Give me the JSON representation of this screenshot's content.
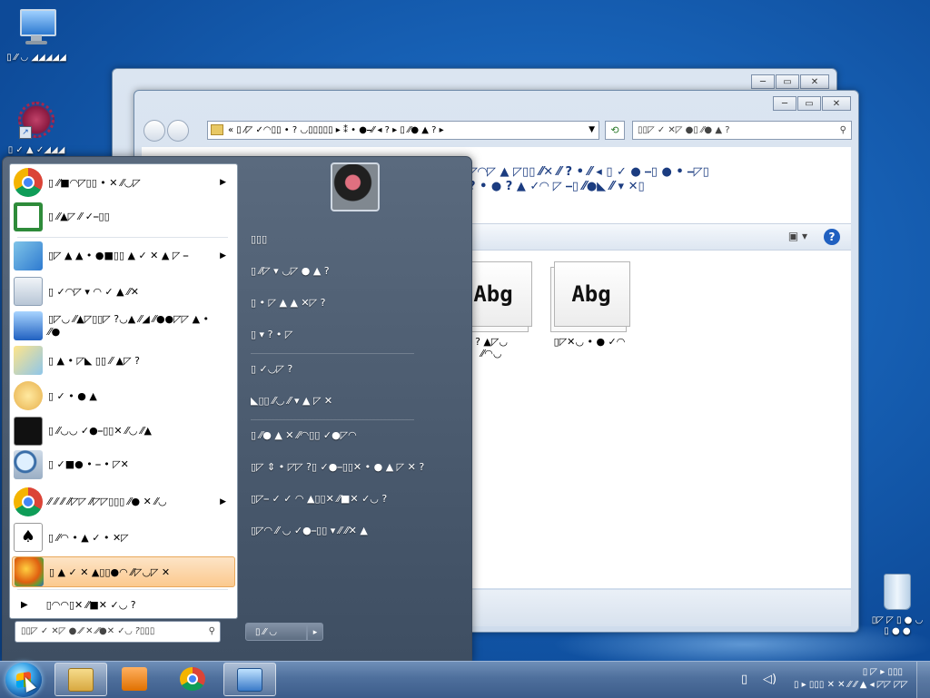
{
  "desktop": {
    "icons": [
      {
        "label": "▯ ⁄⁄ ◡ ◢◢◢◢◢",
        "glyph": "computer-icon"
      },
      {
        "label": "▯ ✓ ▲ ✓◢◢◢",
        "glyph": "web-archive-icon"
      }
    ],
    "recycle_bin_label_line1": "▯◸ ◸ ▯ ● ◡",
    "recycle_bin_label_line2": "▯ ● ●"
  },
  "explorer_back": {
    "min_label": "─",
    "max_label": "▭",
    "close_label": "✕"
  },
  "explorer_front": {
    "min_label": "─",
    "max_label": "▭",
    "close_label": "✕",
    "address_path": "« ▯ ⁄◸ ✓◠▯▯ • ? ◡▯▯▯▯▯  ▸  ⁑ • ●⎯⁄⁄ ◂ ?  ▸ ▯ ⁄⁄● ▲ ?  ▸",
    "search_placeholder": "▯▯◸ ✓ ✕◸ ●▯ ⁄⁄● ▲ ?",
    "info_line1": "◸◠◸ ▲ ◸▯▯ ⁄⁄✕ ⁄⁄ ? • ⁄⁄ ◂ ▯ ✓ ● ⎯▯ ● • ⎯◸▯",
    "info_line2": "? • ● ? ▲ ✓◠ ◸ ⎯▯ ⁄⁄●◣ ⁄⁄ ▾ ✕▯",
    "font_files": [
      {
        "preview": "Abg",
        "name_line1": "? ▲◸◡",
        "name_line2": "⁄⁄◠◡"
      },
      {
        "preview": "Abg",
        "name_line1": "▯◸✕◡ • ● ✓◠",
        "name_line2": ""
      }
    ]
  },
  "start_menu": {
    "left_items": [
      {
        "label": "▯ ⁄⁄■◠◸▯▯ • ✕ ⁄⁄◡◸",
        "icon": "chrome-icon",
        "has_arrow": true
      },
      {
        "label": "▯ ⁄⁄▲◸ ⁄⁄ ✓⎯▯▯",
        "icon": "task-manager-icon",
        "has_arrow": false
      },
      {
        "label": "▯◸ ▲ ▲ • ●■▯▯ ▲ ✓ ✕ ▲ ◸ ⎯",
        "icon": "control-panel-icon",
        "has_arrow": true
      },
      {
        "label": "▯ ✓◠◸ ▾ ◠ ✓ ▲ ⁄⁄✕",
        "icon": "calculator-icon",
        "has_arrow": false
      },
      {
        "label": "▯◸◡ ⁄⁄▲◸▯▯◸ ?◡▲ ⁄⁄◢ ⁄⁄●●◸◸ ▲ • ⁄⁄●",
        "icon": "remote-desktop-icon",
        "has_arrow": false
      },
      {
        "label": "▯ ▲ • ◸◣ ▯▯ ⁄⁄ ▲◸ ?",
        "icon": "snipping-tool-icon",
        "has_arrow": false
      },
      {
        "label": "▯ ✓ • ● ▲",
        "icon": "paint-icon",
        "has_arrow": false
      },
      {
        "label": "▯ ⁄⁄◡◡ ✓●⎯▯▯✕ ⁄⁄◡ ⁄⁄▲",
        "icon": "command-prompt-icon",
        "has_arrow": false
      },
      {
        "label": "▯ ✓■● • ⎯ • ◸✕",
        "icon": "magnifier-icon",
        "has_arrow": false
      },
      {
        "label": "⁄⁄ ⁄⁄ ⁄⁄ ⁄⁄◸◸ ⁄⁄◸◸▯▯▯ ⁄⁄● ✕ ⁄⁄◡",
        "icon": "chrome-user-icon",
        "has_arrow": true
      },
      {
        "label": "▯ ⁄⁄◠ • ▲ ✓ • ✕◸",
        "icon": "solitaire-icon",
        "has_arrow": false
      },
      {
        "label": "▯ ▲ ✓ ✕ ▲▯▯●◠ ⁄⁄◸◡◸ ✕",
        "icon": "getting-started-icon",
        "has_arrow": false,
        "highlighted": true
      }
    ],
    "all_programs_label": "▯◠◠▯✕ ⁄⁄■✕ ✓◡ ?",
    "search_placeholder": "▯▯◸ ✓ ✕◸ ● ⁄⁄ ✕ ⁄⁄●✕ ✓◡ ?▯▯▯",
    "right_items": [
      "▯▯▯",
      "▯ ⁄⁄◸ ▾ ◡◸ ● ▲ ?",
      "▯ • ◸ ▲ ▲ ✕◸ ?",
      "▯ ▾ ? • ◸",
      "▯ ✓◡◸ ?",
      "◣▯▯ ⁄⁄◡ ⁄⁄ ▾ ▲ ◸ ✕",
      "▯ ⁄⁄● ▲ ✕ ⁄⁄◠▯▯ ✓●◸◠",
      "▯◸ ⇕ • ◸◸ ?▯ ✓●⎯▯▯✕ • ● ▲ ◸ ✕ ?",
      "▯◸⎯ ✓ ✓ ◠ ▲▯▯✕ ⁄⁄■✕ ✓◡ ?",
      "▯◸◠ ⁄⁄ ◡ ✓●⎯▯▯ ▾ ⁄⁄ ⁄⁄✕ ▲"
    ],
    "shutdown_label": "▯ ⁄⁄ ◡",
    "shutdown_arrow": "▸"
  },
  "taskbar": {
    "pinned": [
      "windows-explorer-icon",
      "media-player-icon",
      "chrome-icon",
      "remote-desktop-icon"
    ],
    "tray_network": "▯",
    "tray_volume": "◁)",
    "clock_line1": "▯ ◸ ▸ ▯▯▯",
    "clock_line2": "▯ ▸ ▯▯▯ ✕ ✕ ⁄⁄ ⁄⁄ ▲ ◂ ◸◸ ◸◸"
  }
}
